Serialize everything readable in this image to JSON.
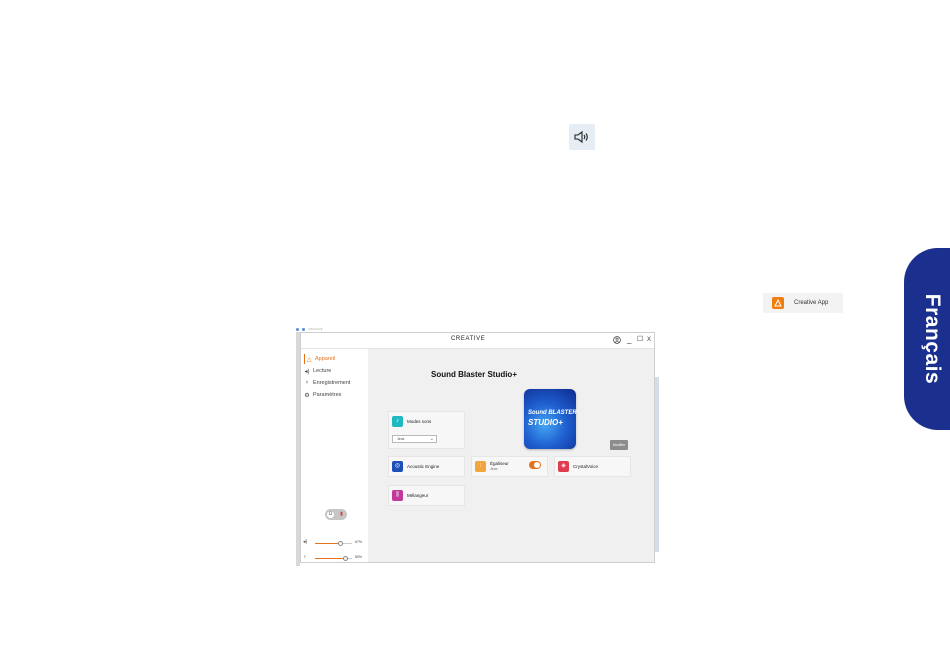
{
  "speaker_icon": "speaker-volume-icon",
  "taskbar_app": {
    "label": "Creative App",
    "icon": "creative-app-icon",
    "color": "#f07d0e"
  },
  "language_tab": {
    "label": "Français",
    "color": "#1b2f8f"
  },
  "window": {
    "logo": "CREATIVE",
    "controls": {
      "account": "account-icon",
      "minimize": "_",
      "maximize": "☐",
      "close": "X"
    },
    "nav": [
      {
        "label": "Appareil",
        "icon": "device-icon",
        "active": true
      },
      {
        "label": "Lecture",
        "icon": "speaker-icon",
        "active": false
      },
      {
        "label": "Enregistrement",
        "icon": "microphone-icon",
        "active": false
      },
      {
        "label": "Paramètres",
        "icon": "gear-icon",
        "active": false
      }
    ],
    "output_toggle": {
      "left_icon": "headphone-icon",
      "right_icon": "speaker-icon"
    },
    "volume": {
      "speaker_value": "67%",
      "speaker_level": 0.67,
      "mic_value": "80%",
      "mic_level": 0.8
    },
    "device_title": "Sound Blaster Studio+",
    "product_image": {
      "line1": "Sound BLASTER",
      "line2": "STUDIO+"
    },
    "modify_label": "Modifier",
    "cards": {
      "sound_modes": {
        "title": "Modes sons",
        "select_value": "Jeux",
        "color": "#1fb9c2"
      },
      "acoustic_engine": {
        "title": "Acoustic Engine",
        "color": "#1d4fb8"
      },
      "equalizer": {
        "title": "Égaliseur",
        "subtitle": "Jeux",
        "color": "#f2a53c",
        "enabled": true
      },
      "crystalvoice": {
        "title": "CrystalVoice",
        "color": "#e03c4f"
      },
      "mixer": {
        "title": "Mélangeur",
        "color": "#c3379a"
      }
    }
  }
}
